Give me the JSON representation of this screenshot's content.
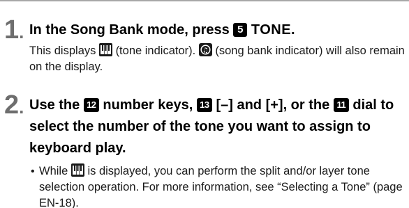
{
  "steps": [
    {
      "number": "1",
      "dot": ".",
      "title_part1": "In the Song Bank mode, press",
      "title_badge": "5",
      "title_button": "TONE",
      "title_end": ".",
      "body_part1": "This displays",
      "body_icon1": "tone-indicator-icon",
      "body_part2": "(tone indicator).",
      "body_icon2": "song-bank-indicator-icon",
      "body_part3": "(song bank indicator) will also remain on the display."
    },
    {
      "number": "2",
      "dot": ".",
      "title_part1": "Use the",
      "badge_a": "12",
      "title_part2": "number keys,",
      "badge_b": "13",
      "title_part3": "[–] and [+], or the",
      "badge_c": "11",
      "title_part4": "dial to select the number of the tone you want to assign to keyboard play.",
      "bullet_symbol": "•",
      "bullet_part1": "While",
      "bullet_icon": "tone-indicator-icon",
      "bullet_part2": "is displayed, you can perform the split and/or layer tone selection operation. For more information, see “Selecting a Tone” (page EN-18)."
    }
  ]
}
